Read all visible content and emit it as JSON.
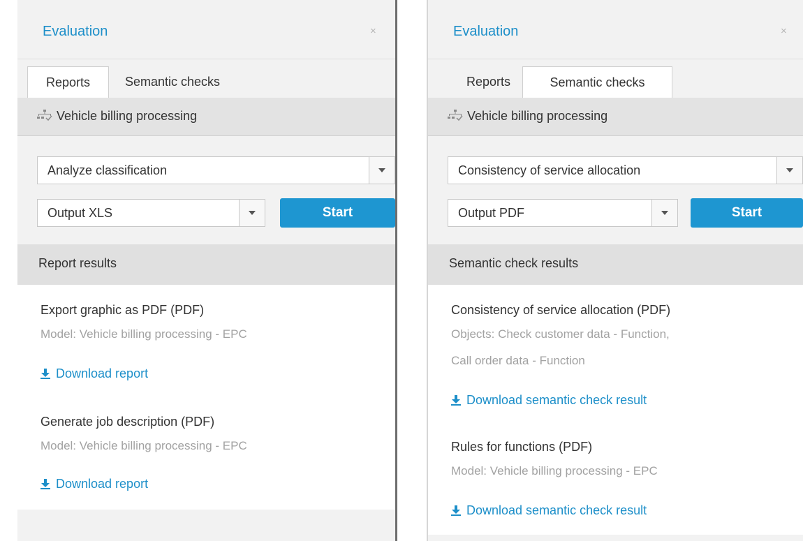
{
  "panels": [
    {
      "title": "Evaluation",
      "close_glyph": "×",
      "tabs": [
        "Reports",
        "Semantic checks"
      ],
      "active_tab": 0,
      "model_icon": "process-model-icon",
      "model_name": "Vehicle billing processing",
      "select_primary": "Analyze classification",
      "select_output": "Output XLS",
      "start_label": "Start",
      "results_header": "Report results",
      "results": [
        {
          "title": "Export graphic as PDF  (PDF)",
          "meta": [
            "Model: Vehicle billing processing - EPC"
          ],
          "link": "Download report"
        },
        {
          "title": "Generate job description  (PDF)",
          "meta": [
            "Model: Vehicle billing processing - EPC"
          ],
          "link": "Download report"
        }
      ]
    },
    {
      "title": "Evaluation",
      "close_glyph": "×",
      "tabs": [
        "Reports",
        "Semantic checks"
      ],
      "active_tab": 1,
      "model_icon": "process-model-icon",
      "model_name": "Vehicle billing processing",
      "select_primary": "Consistency of service allocation",
      "select_output": "Output PDF",
      "start_label": "Start",
      "results_header": "Semantic check results",
      "results": [
        {
          "title": "Consistency of service allocation  (PDF)",
          "meta": [
            "Objects: Check customer data - Function,",
            "Call order data - Function"
          ],
          "link": "Download semantic check result"
        },
        {
          "title": "Rules for functions  (PDF)",
          "meta": [
            "Model: Vehicle billing processing - EPC"
          ],
          "link": "Download semantic check result"
        }
      ]
    }
  ],
  "colors": {
    "accent": "#1d8fc9",
    "button": "#1e96d1",
    "panel_bg": "#f2f2f2",
    "muted_text": "#a2a2a2"
  }
}
